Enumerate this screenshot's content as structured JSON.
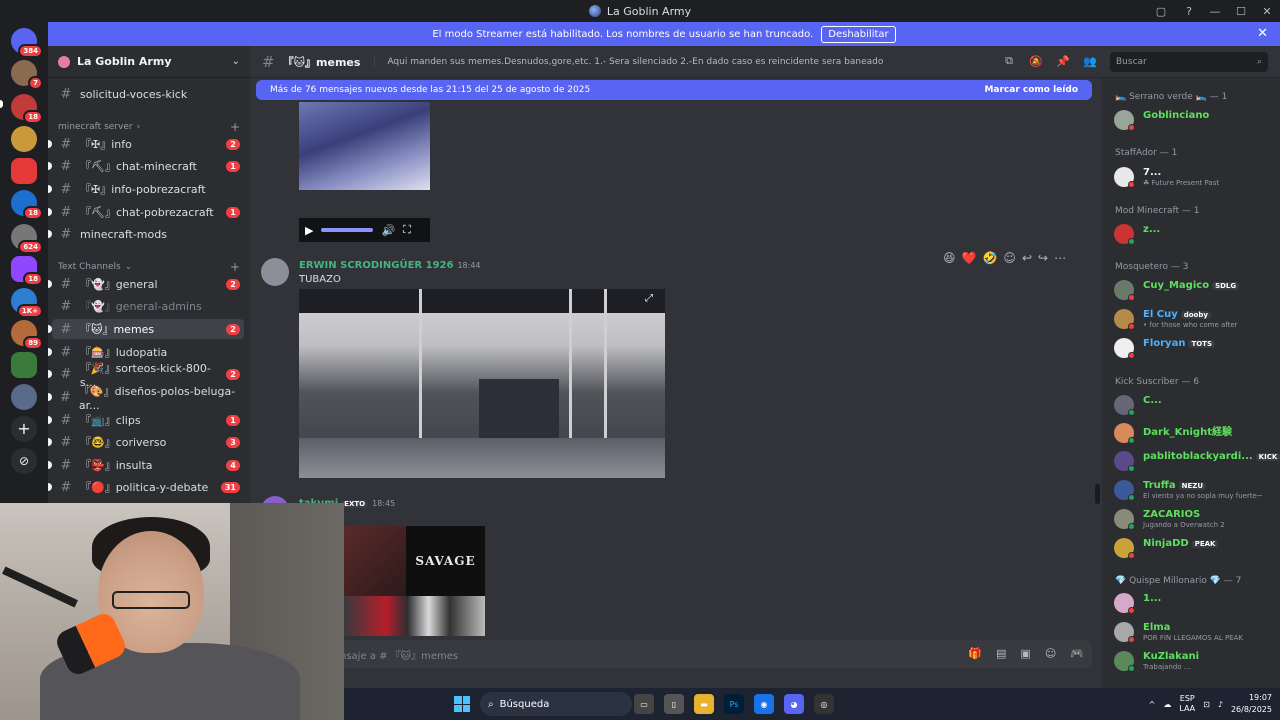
{
  "window": {
    "title": "La Goblin Army"
  },
  "banner": {
    "text": "El modo Streamer está habilitado. Los nombres de usuario se han truncado.",
    "button": "Deshabilitar"
  },
  "rail": {
    "badges": [
      "384",
      "7",
      "18",
      "18",
      "624",
      "18",
      "1K+",
      "89"
    ]
  },
  "guild": {
    "name": "La Goblin Army"
  },
  "sidebar": {
    "top_channel": "solicitud-voces-kick",
    "cat1": "minecraft server",
    "cat1_channels": [
      {
        "name": "『✠』info",
        "badge": "2"
      },
      {
        "name": "『⛏』chat-minecraft",
        "badge": "1"
      },
      {
        "name": "『✠』info-pobrezacraft",
        "badge": ""
      },
      {
        "name": "『⛏』chat-pobrezacraft",
        "badge": "1"
      },
      {
        "name": "minecraft-mods",
        "badge": ""
      }
    ],
    "cat2": "Text Channels",
    "cat2_channels": [
      {
        "name": "『👻』general",
        "badge": "2"
      },
      {
        "name": "『👻』general-admins",
        "badge": ""
      },
      {
        "name": "『🐱』memes",
        "badge": "2"
      },
      {
        "name": "『🎰』ludopatia",
        "badge": ""
      },
      {
        "name": "『🎉』sorteos-kick-800-s...",
        "badge": "2"
      },
      {
        "name": "『🎨』diseños-polos-beluga-ar...",
        "badge": ""
      },
      {
        "name": "『📺』clips",
        "badge": "1"
      },
      {
        "name": "『🤓』coriverso",
        "badge": "3"
      },
      {
        "name": "『👺』insulta",
        "badge": "4"
      },
      {
        "name": "『🔴』politica-y-debate",
        "badge": "31"
      }
    ]
  },
  "header": {
    "channel": "『🐱』memes",
    "topic": "Aqui manden sus memes.Desnudos,gore,etc. 1.- Sera silenciado 2.-En dado caso es reincidente sera baneado",
    "search_placeholder": "Buscar"
  },
  "newbar": {
    "text": "Más de 76 mensajes nuevos desde las 21:15 del 25 de agosto de 2025",
    "action": "Marcar como leído"
  },
  "messages": [
    {
      "author": "ERWIN SCRODINGÜER 1926",
      "time": "18:44",
      "text": "TUBAZO"
    },
    {
      "author": "takumi",
      "tag": "EXTO",
      "time": "18:45"
    }
  ],
  "image2": {
    "logo": "SAVAGE"
  },
  "composer": {
    "placeholder": "nsaje a # 『🐱』memes"
  },
  "members": {
    "groups": [
      {
        "title": "🛌 Serrano verde 🛌 — 1",
        "items": [
          {
            "name": "Goblinciano",
            "sub": "",
            "tag": "",
            "color": "#5ee05e"
          }
        ]
      },
      {
        "title": "StaffAdor — 1",
        "items": [
          {
            "name": "7...",
            "sub": "☘ Future Present Past",
            "tag": "",
            "color": "#f2f3f5"
          }
        ]
      },
      {
        "title": "Mod Minecraft — 1",
        "items": [
          {
            "name": "z...",
            "sub": "",
            "tag": "",
            "color": "#5ee05e"
          }
        ]
      },
      {
        "title": "Mosquetero — 3",
        "items": [
          {
            "name": "Cuy_Magico",
            "sub": "",
            "tag": "SDLG",
            "color": "#5ee05e"
          },
          {
            "name": "El Cuy",
            "sub": "• for those who come after",
            "tag": "dooby",
            "color": "#4fb0ff"
          },
          {
            "name": "Floryan",
            "sub": "",
            "tag": "TOTS",
            "color": "#4fb0ff"
          }
        ]
      },
      {
        "title": "Kick Suscriber — 6",
        "items": [
          {
            "name": "C...",
            "sub": "",
            "tag": "",
            "color": "#5ee05e"
          },
          {
            "name": "Dark_Knight経験",
            "sub": "",
            "tag": "",
            "color": "#5ee05e"
          },
          {
            "name": "pablitoblackyardi...",
            "sub": "",
            "tag": "KICK",
            "color": "#5ee05e"
          },
          {
            "name": "Truffa",
            "sub": "El viento ya no sopla muy fuerte~",
            "tag": "NEZU",
            "color": "#5ee05e"
          },
          {
            "name": "ZACARIOS",
            "sub": "Jugando a Overwatch 2",
            "tag": "",
            "color": "#5ee05e"
          },
          {
            "name": "NinjaDD",
            "sub": "",
            "tag": "PEAK",
            "color": "#5ee05e"
          }
        ]
      },
      {
        "title": "💎 Quispe Millonario 💎 — 7",
        "items": [
          {
            "name": "1...",
            "sub": "",
            "tag": "",
            "color": "#5ee05e"
          },
          {
            "name": "Elma",
            "sub": "POR FIN LLEGAMOS AL PEAK",
            "tag": "",
            "color": "#5ee05e"
          },
          {
            "name": "KuZlakani",
            "sub": "Trabajando ...",
            "tag": "",
            "color": "#5ee05e"
          }
        ]
      }
    ]
  },
  "taskbar": {
    "search": "Búsqueda",
    "lang": "ESP",
    "lang2": "LAA",
    "time": "19:07",
    "date": "26/8/2025"
  },
  "colors": {
    "blurple": "#5865f2",
    "bg": "#313338",
    "sidebar": "#2b2d31",
    "rail": "#1e1f22",
    "danger": "#f23f43",
    "online": "#23a55a"
  }
}
